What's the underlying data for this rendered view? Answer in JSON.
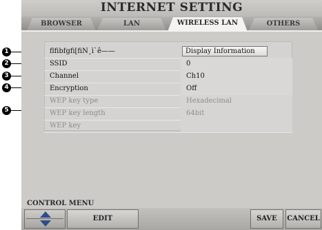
{
  "title": "INTERNET SETTING",
  "tabs": [
    {
      "label": "BROWSER",
      "active": false
    },
    {
      "label": "LAN",
      "active": false
    },
    {
      "label": "WIRELESS LAN",
      "active": true
    },
    {
      "label": "OTHERS",
      "active": false
    }
  ],
  "rows": [
    {
      "label": "ﬂﬁbfgﬁ[ﬁN¸ì`ê——",
      "value": "Display Information",
      "type": "button"
    },
    {
      "label": "SSID",
      "value": "0"
    },
    {
      "label": "Channel",
      "value": "Ch10"
    },
    {
      "label": "Encryption",
      "value": "Off"
    },
    {
      "label": "WEP key type",
      "value": "Hexadecimal",
      "disabled": true
    },
    {
      "label": "WEP key length",
      "value": "64bit",
      "disabled": true
    },
    {
      "label": "WEP key",
      "value": "",
      "disabled": true
    }
  ],
  "callouts": [
    "1",
    "2",
    "3",
    "4",
    "5"
  ],
  "control_menu": {
    "label": "CONTROL MENU",
    "edit": "EDIT",
    "save": "SAVE",
    "cancel": "CANCEL"
  },
  "colors": {
    "accent_arrow": "#2f4d8a",
    "screen_bg": "#cdcbc8"
  }
}
